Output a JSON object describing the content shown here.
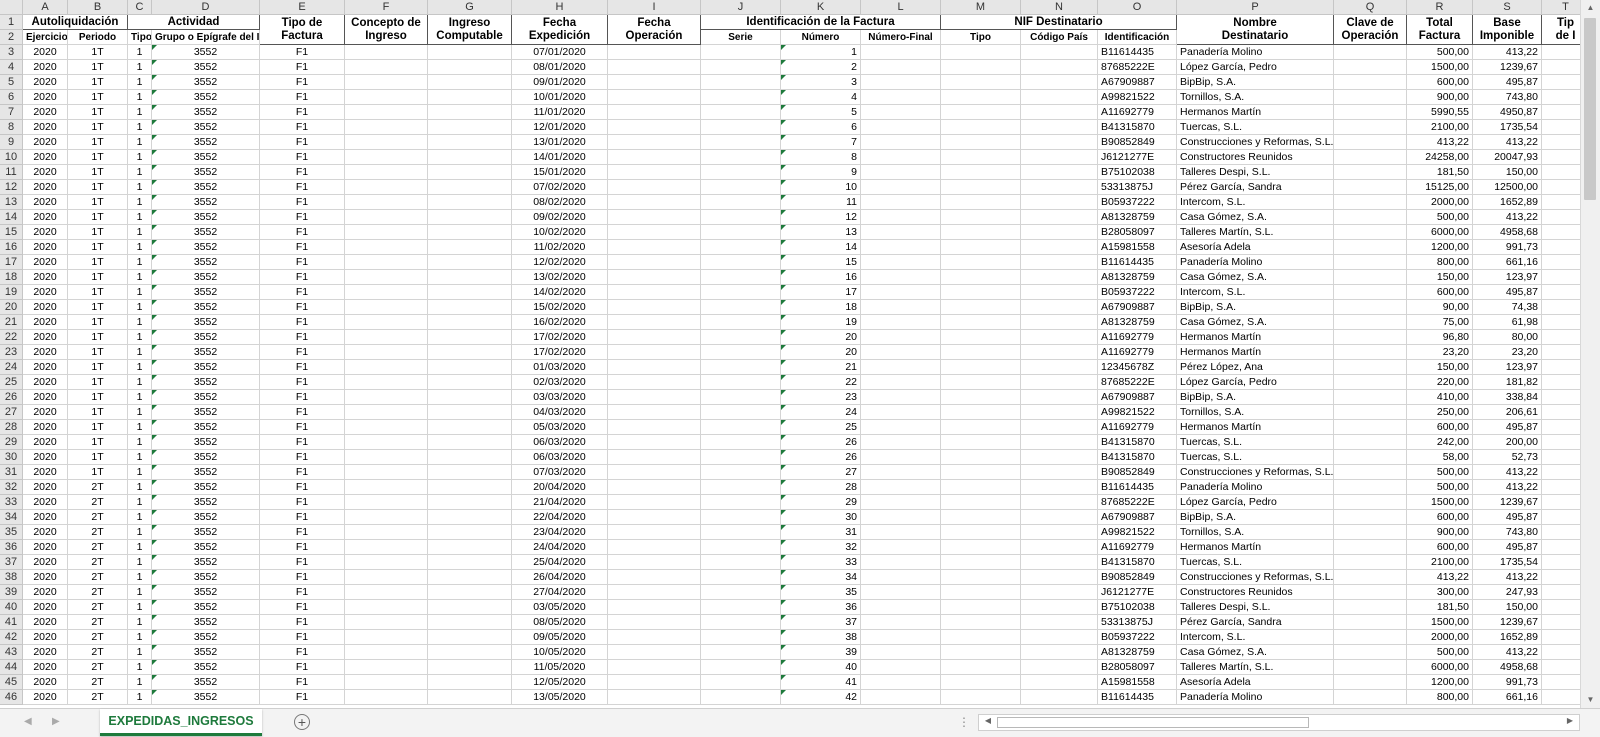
{
  "columns": [
    "A",
    "B",
    "C",
    "D",
    "E",
    "F",
    "G",
    "H",
    "I",
    "J",
    "K",
    "L",
    "M",
    "N",
    "O",
    "P",
    "Q",
    "R",
    "S",
    "T"
  ],
  "row_numbers": [
    "1",
    "2",
    "3",
    "4",
    "5",
    "6",
    "7",
    "8",
    "9",
    "10",
    "11",
    "12",
    "13",
    "14",
    "15",
    "16",
    "17",
    "18",
    "19",
    "20",
    "21",
    "22",
    "23",
    "24",
    "25",
    "26",
    "27",
    "28",
    "29",
    "30",
    "31",
    "32",
    "33",
    "34",
    "35",
    "36",
    "37",
    "38",
    "39",
    "40",
    "41",
    "42",
    "43",
    "44",
    "45",
    "46"
  ],
  "header_bands": [
    {
      "label": "Autoliquidación"
    },
    {
      "label": "Actividad"
    },
    {
      "label": "Tipo de\nFactura"
    },
    {
      "label": "Concepto de\nIngreso"
    },
    {
      "label": "Ingreso\nComputable"
    },
    {
      "label": "Fecha\nExpedición"
    },
    {
      "label": "Fecha\nOperación"
    },
    {
      "label": "Identificación de la Factura"
    },
    {
      "label": "NIF Destinatario"
    },
    {
      "label": "Nombre\nDestinatario"
    },
    {
      "label": "Clave de\nOperación"
    },
    {
      "label": "Total\nFactura"
    },
    {
      "label": "Base\nImponible"
    },
    {
      "label": "Tip\nde I"
    }
  ],
  "sub_headers": [
    "Ejercicio",
    "Periodo",
    "Tipo",
    "Grupo o Epígrafe del IAE",
    "Serie",
    "Número",
    "Número-Final",
    "Tipo",
    "Código País",
    "Identificación"
  ],
  "rows": [
    [
      "2020",
      "1T",
      "1",
      "3552",
      "F1",
      "07/01/2020",
      "1",
      "B11614435",
      "Panadería Molino",
      "500,00",
      "413,22"
    ],
    [
      "2020",
      "1T",
      "1",
      "3552",
      "F1",
      "08/01/2020",
      "2",
      "87685222E",
      "López García, Pedro",
      "1500,00",
      "1239,67"
    ],
    [
      "2020",
      "1T",
      "1",
      "3552",
      "F1",
      "09/01/2020",
      "3",
      "A67909887",
      "BipBip, S.A.",
      "600,00",
      "495,87"
    ],
    [
      "2020",
      "1T",
      "1",
      "3552",
      "F1",
      "10/01/2020",
      "4",
      "A99821522",
      "Tornillos, S.A.",
      "900,00",
      "743,80"
    ],
    [
      "2020",
      "1T",
      "1",
      "3552",
      "F1",
      "11/01/2020",
      "5",
      "A11692779",
      "Hermanos Martín",
      "5990,55",
      "4950,87"
    ],
    [
      "2020",
      "1T",
      "1",
      "3552",
      "F1",
      "12/01/2020",
      "6",
      "B41315870",
      "Tuercas, S.L.",
      "2100,00",
      "1735,54"
    ],
    [
      "2020",
      "1T",
      "1",
      "3552",
      "F1",
      "13/01/2020",
      "7",
      "B90852849",
      "Construcciones y Reformas, S.L.",
      "413,22",
      "413,22"
    ],
    [
      "2020",
      "1T",
      "1",
      "3552",
      "F1",
      "14/01/2020",
      "8",
      "J6121277E",
      "Constructores Reunidos",
      "24258,00",
      "20047,93"
    ],
    [
      "2020",
      "1T",
      "1",
      "3552",
      "F1",
      "15/01/2020",
      "9",
      "B75102038",
      "Talleres Despi, S.L.",
      "181,50",
      "150,00"
    ],
    [
      "2020",
      "1T",
      "1",
      "3552",
      "F1",
      "07/02/2020",
      "10",
      "53313875J",
      "Pérez García, Sandra",
      "15125,00",
      "12500,00"
    ],
    [
      "2020",
      "1T",
      "1",
      "3552",
      "F1",
      "08/02/2020",
      "11",
      "B05937222",
      "Intercom, S.L.",
      "2000,00",
      "1652,89"
    ],
    [
      "2020",
      "1T",
      "1",
      "3552",
      "F1",
      "09/02/2020",
      "12",
      "A81328759",
      "Casa Gómez, S.A.",
      "500,00",
      "413,22"
    ],
    [
      "2020",
      "1T",
      "1",
      "3552",
      "F1",
      "10/02/2020",
      "13",
      "B28058097",
      "Talleres Martín, S.L.",
      "6000,00",
      "4958,68"
    ],
    [
      "2020",
      "1T",
      "1",
      "3552",
      "F1",
      "11/02/2020",
      "14",
      "A15981558",
      "Asesoría Adela",
      "1200,00",
      "991,73"
    ],
    [
      "2020",
      "1T",
      "1",
      "3552",
      "F1",
      "12/02/2020",
      "15",
      "B11614435",
      "Panadería Molino",
      "800,00",
      "661,16"
    ],
    [
      "2020",
      "1T",
      "1",
      "3552",
      "F1",
      "13/02/2020",
      "16",
      "A81328759",
      "Casa Gómez, S.A.",
      "150,00",
      "123,97"
    ],
    [
      "2020",
      "1T",
      "1",
      "3552",
      "F1",
      "14/02/2020",
      "17",
      "B05937222",
      "Intercom, S.L.",
      "600,00",
      "495,87"
    ],
    [
      "2020",
      "1T",
      "1",
      "3552",
      "F1",
      "15/02/2020",
      "18",
      "A67909887",
      "BipBip, S.A.",
      "90,00",
      "74,38"
    ],
    [
      "2020",
      "1T",
      "1",
      "3552",
      "F1",
      "16/02/2020",
      "19",
      "A81328759",
      "Casa Gómez, S.A.",
      "75,00",
      "61,98"
    ],
    [
      "2020",
      "1T",
      "1",
      "3552",
      "F1",
      "17/02/2020",
      "20",
      "A11692779",
      "Hermanos Martín",
      "96,80",
      "80,00"
    ],
    [
      "2020",
      "1T",
      "1",
      "3552",
      "F1",
      "17/02/2020",
      "20",
      "A11692779",
      "Hermanos Martín",
      "23,20",
      "23,20"
    ],
    [
      "2020",
      "1T",
      "1",
      "3552",
      "F1",
      "01/03/2020",
      "21",
      "12345678Z",
      "Pérez López, Ana",
      "150,00",
      "123,97"
    ],
    [
      "2020",
      "1T",
      "1",
      "3552",
      "F1",
      "02/03/2020",
      "22",
      "87685222E",
      "López García, Pedro",
      "220,00",
      "181,82"
    ],
    [
      "2020",
      "1T",
      "1",
      "3552",
      "F1",
      "03/03/2020",
      "23",
      "A67909887",
      "BipBip, S.A.",
      "410,00",
      "338,84"
    ],
    [
      "2020",
      "1T",
      "1",
      "3552",
      "F1",
      "04/03/2020",
      "24",
      "A99821522",
      "Tornillos, S.A.",
      "250,00",
      "206,61"
    ],
    [
      "2020",
      "1T",
      "1",
      "3552",
      "F1",
      "05/03/2020",
      "25",
      "A11692779",
      "Hermanos Martín",
      "600,00",
      "495,87"
    ],
    [
      "2020",
      "1T",
      "1",
      "3552",
      "F1",
      "06/03/2020",
      "26",
      "B41315870",
      "Tuercas, S.L.",
      "242,00",
      "200,00"
    ],
    [
      "2020",
      "1T",
      "1",
      "3552",
      "F1",
      "06/03/2020",
      "26",
      "B41315870",
      "Tuercas, S.L.",
      "58,00",
      "52,73"
    ],
    [
      "2020",
      "1T",
      "1",
      "3552",
      "F1",
      "07/03/2020",
      "27",
      "B90852849",
      "Construcciones y Reformas, S.L.",
      "500,00",
      "413,22"
    ],
    [
      "2020",
      "2T",
      "1",
      "3552",
      "F1",
      "20/04/2020",
      "28",
      "B11614435",
      "Panadería Molino",
      "500,00",
      "413,22"
    ],
    [
      "2020",
      "2T",
      "1",
      "3552",
      "F1",
      "21/04/2020",
      "29",
      "87685222E",
      "López García, Pedro",
      "1500,00",
      "1239,67"
    ],
    [
      "2020",
      "2T",
      "1",
      "3552",
      "F1",
      "22/04/2020",
      "30",
      "A67909887",
      "BipBip, S.A.",
      "600,00",
      "495,87"
    ],
    [
      "2020",
      "2T",
      "1",
      "3552",
      "F1",
      "23/04/2020",
      "31",
      "A99821522",
      "Tornillos, S.A.",
      "900,00",
      "743,80"
    ],
    [
      "2020",
      "2T",
      "1",
      "3552",
      "F1",
      "24/04/2020",
      "32",
      "A11692779",
      "Hermanos Martín",
      "600,00",
      "495,87"
    ],
    [
      "2020",
      "2T",
      "1",
      "3552",
      "F1",
      "25/04/2020",
      "33",
      "B41315870",
      "Tuercas, S.L.",
      "2100,00",
      "1735,54"
    ],
    [
      "2020",
      "2T",
      "1",
      "3552",
      "F1",
      "26/04/2020",
      "34",
      "B90852849",
      "Construcciones y Reformas, S.L.",
      "413,22",
      "413,22"
    ],
    [
      "2020",
      "2T",
      "1",
      "3552",
      "F1",
      "27/04/2020",
      "35",
      "J6121277E",
      "Constructores Reunidos",
      "300,00",
      "247,93"
    ],
    [
      "2020",
      "2T",
      "1",
      "3552",
      "F1",
      "03/05/2020",
      "36",
      "B75102038",
      "Talleres Despi, S.L.",
      "181,50",
      "150,00"
    ],
    [
      "2020",
      "2T",
      "1",
      "3552",
      "F1",
      "08/05/2020",
      "37",
      "53313875J",
      "Pérez García, Sandra",
      "1500,00",
      "1239,67"
    ],
    [
      "2020",
      "2T",
      "1",
      "3552",
      "F1",
      "09/05/2020",
      "38",
      "B05937222",
      "Intercom, S.L.",
      "2000,00",
      "1652,89"
    ],
    [
      "2020",
      "2T",
      "1",
      "3552",
      "F1",
      "10/05/2020",
      "39",
      "A81328759",
      "Casa Gómez, S.A.",
      "500,00",
      "413,22"
    ],
    [
      "2020",
      "2T",
      "1",
      "3552",
      "F1",
      "11/05/2020",
      "40",
      "B28058097",
      "Talleres Martín, S.L.",
      "6000,00",
      "4958,68"
    ],
    [
      "2020",
      "2T",
      "1",
      "3552",
      "F1",
      "12/05/2020",
      "41",
      "A15981558",
      "Asesoría Adela",
      "1200,00",
      "991,73"
    ],
    [
      "2020",
      "2T",
      "1",
      "3552",
      "F1",
      "13/05/2020",
      "42",
      "B11614435",
      "Panadería Molino",
      "800,00",
      "661,16"
    ]
  ],
  "sheet_tab": {
    "label": "EXPEDIDAS_INGRESOS"
  },
  "icons": {
    "add_sheet": "plus-circle-icon",
    "scroll_left": "triangle-left-icon",
    "scroll_right": "triangle-right-icon",
    "scroll_up": "triangle-up-icon",
    "scroll_down": "triangle-down-icon"
  }
}
